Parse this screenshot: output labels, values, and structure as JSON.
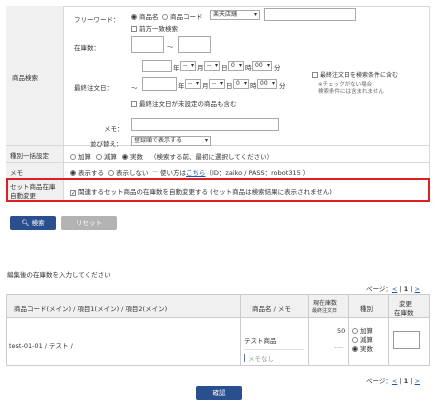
{
  "search_form": {
    "section_label": "商品検索",
    "freeword": {
      "label": "フリーワード：",
      "radio_name": "商品名",
      "radio_code": "商品コード",
      "store_select": "楽天店舗",
      "prefix_match": "前方一致検索",
      "value": ""
    },
    "stock": {
      "label": "在庫数：",
      "tilde": "～",
      "min": "",
      "max": ""
    },
    "last_order": {
      "label": "最終注文日：",
      "tilde": "～",
      "from": {
        "year_unit": "年",
        "month": "--",
        "month_unit": "月",
        "day": "--",
        "day_unit": "日",
        "hour": "0",
        "hour_unit": "時",
        "minute": "00",
        "minute_unit": "分"
      },
      "to": {
        "year_unit": "年",
        "month": "--",
        "month_unit": "月",
        "day": "--",
        "day_unit": "日",
        "hour": "0",
        "hour_unit": "時",
        "minute": "00",
        "minute_unit": "分"
      },
      "include_condition": "最終注文日を検索条件に含む",
      "note_line1": "※チェックがない場合",
      "note_line2": "検索条件には含まれません",
      "include_unset": "最終注文日が未設定の商品も含む"
    },
    "memo": {
      "label": "メモ：",
      "value": ""
    },
    "sort": {
      "label": "並び替え：",
      "value": "登録順で表示する"
    }
  },
  "bulk_type": {
    "label": "種別一括設定",
    "opt_add": "加算",
    "opt_sub": "減算",
    "opt_actual": "実数",
    "note": "（検索する前、最初に選択してください）"
  },
  "memo_display": {
    "label": "メモ",
    "opt_show": "表示する",
    "opt_hide": "表示しない",
    "usage_prefix": "使い方は",
    "usage_link": "こちら",
    "credentials": "（ID：zaiko / PASS：robot315 ）"
  },
  "set_auto": {
    "label_line1": "セット商品在庫",
    "label_line2": "自動変更",
    "text": "関連するセット商品の在庫数を自動変更する (セット商品は検索結果に表示されません)"
  },
  "buttons": {
    "search": "検索",
    "reset": "リセット",
    "confirm": "確認"
  },
  "instruction": "編集後の在庫数を入力してください",
  "pager": {
    "prefix": "ページ：",
    "lt": "<",
    "sep": "|",
    "current": "1",
    "gt": ">"
  },
  "results": {
    "headers": {
      "code": "商品コード(メイン) / 項目1(メイン) / 項目2(メイン)",
      "name_memo": "商品名 / メモ",
      "current_stock": "現在庫数",
      "last_order": "最終注文日",
      "type": "種別",
      "change_line1": "変更",
      "change_line2": "在庫数"
    },
    "rows": [
      {
        "code": "test-01-01 / テスト /",
        "name": "テスト商品",
        "memo": "メモなし",
        "stock": "50",
        "last_order": "----",
        "type_add": "加算",
        "type_sub": "減算",
        "type_actual": "実数",
        "new_stock": ""
      }
    ]
  },
  "colors": {
    "primary_button": "#2a4f8f",
    "disabled_button": "#b3b3b3",
    "highlight_border": "#e02020",
    "link": "#1a5bb5"
  }
}
